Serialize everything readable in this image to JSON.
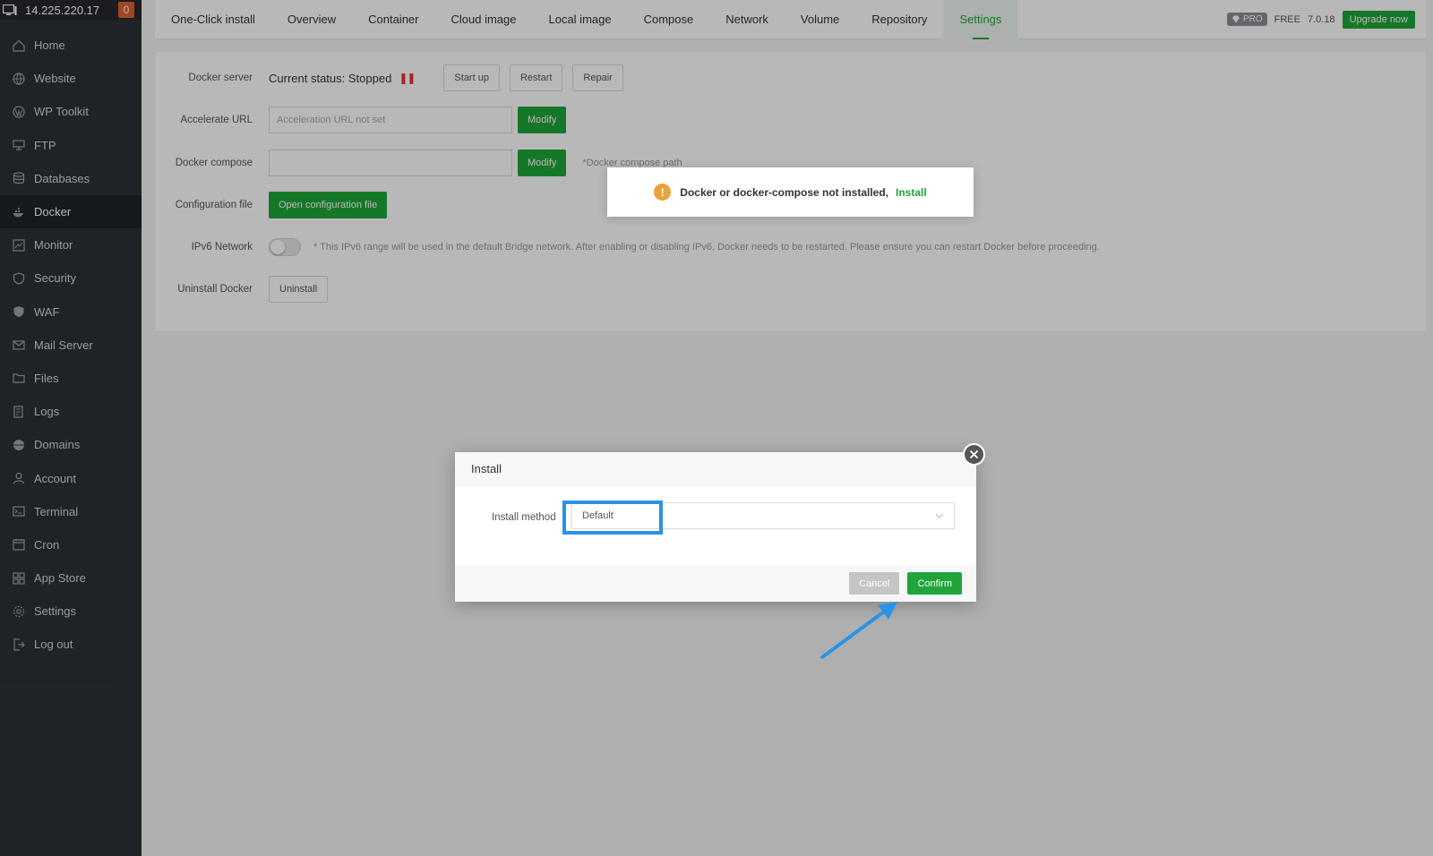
{
  "server": {
    "ip": "14.225.220.17",
    "badge_count": "0"
  },
  "sidebar": {
    "items": [
      {
        "label": "Home",
        "icon": "home-icon"
      },
      {
        "label": "Website",
        "icon": "globe-icon"
      },
      {
        "label": "WP Toolkit",
        "icon": "wordpress-icon"
      },
      {
        "label": "FTP",
        "icon": "ftp-icon"
      },
      {
        "label": "Databases",
        "icon": "database-icon"
      },
      {
        "label": "Docker",
        "icon": "docker-icon",
        "active": true
      },
      {
        "label": "Monitor",
        "icon": "monitor-icon"
      },
      {
        "label": "Security",
        "icon": "shield-icon"
      },
      {
        "label": "WAF",
        "icon": "waf-shield-icon"
      },
      {
        "label": "Mail Server",
        "icon": "mail-icon"
      },
      {
        "label": "Files",
        "icon": "folder-icon"
      },
      {
        "label": "Logs",
        "icon": "logs-icon"
      },
      {
        "label": "Domains",
        "icon": "domains-icon"
      },
      {
        "label": "Account",
        "icon": "user-icon"
      },
      {
        "label": "Terminal",
        "icon": "terminal-icon"
      },
      {
        "label": "Cron",
        "icon": "calendar-icon"
      },
      {
        "label": "App Store",
        "icon": "grid-icon"
      },
      {
        "label": "Settings",
        "icon": "gear-icon"
      },
      {
        "label": "Log out",
        "icon": "logout-icon"
      }
    ]
  },
  "tabs": [
    {
      "label": "One-Click install"
    },
    {
      "label": "Overview"
    },
    {
      "label": "Container"
    },
    {
      "label": "Cloud image"
    },
    {
      "label": "Local image"
    },
    {
      "label": "Compose"
    },
    {
      "label": "Network"
    },
    {
      "label": "Volume"
    },
    {
      "label": "Repository"
    },
    {
      "label": "Settings",
      "active": true
    }
  ],
  "header_right": {
    "pro_label": "PRO",
    "free_label": "FREE",
    "version": "7.0.18",
    "upgrade_label": "Upgrade now"
  },
  "settings": {
    "docker_server": {
      "label": "Docker server",
      "status": "Current status: Stopped",
      "start": "Start up",
      "restart": "Restart",
      "repair": "Repair"
    },
    "accelerate_url": {
      "label": "Accelerate URL",
      "placeholder": "Acceleration URL not set",
      "modify": "Modify"
    },
    "docker_compose": {
      "label": "Docker compose",
      "value": "",
      "modify": "Modify",
      "hint": "*Docker compose path"
    },
    "config_file": {
      "label": "Configuration file",
      "button": "Open configuration file"
    },
    "ipv6": {
      "label": "IPv6 Network",
      "enabled": false,
      "hint": "* This IPv6 range will be used in the default Bridge network. After enabling or disabling IPv6, Docker needs to be restarted. Please ensure you can restart Docker before proceeding."
    },
    "uninstall": {
      "label": "Uninstall Docker",
      "button": "Uninstall"
    }
  },
  "toast": {
    "message": "Docker or docker-compose not installed,",
    "link": "Install"
  },
  "modal": {
    "title": "Install",
    "field_label": "Install method",
    "selected": "Default",
    "cancel": "Cancel",
    "confirm": "Confirm"
  },
  "colors": {
    "accent": "#20a53a",
    "sidebar_bg": "#2c3036",
    "highlight": "#2a93e6",
    "warning": "#e8a33a"
  }
}
